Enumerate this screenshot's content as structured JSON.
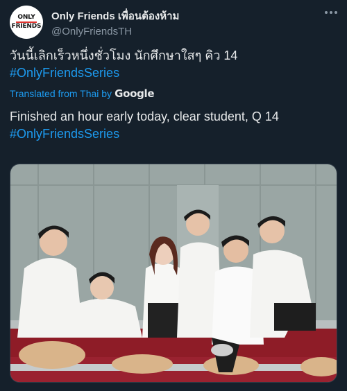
{
  "account": {
    "display_name": "Only Friends เพื่อนต้องห้าม",
    "handle": "@OnlyFriendsTH",
    "logo_text_top": "ONLY",
    "logo_text_bottom": "FRIENDS"
  },
  "tweet": {
    "original_text": "วันนี้เลิกเร็วหนึ่งชั่วโมง นักศึกษาใสๆ คิว 14",
    "original_hashtag": "#OnlyFriendsSeries",
    "translated_from": "Translated from Thai by",
    "translator": "Google",
    "translated_text": "Finished an hour early today, clear student, Q 14",
    "translated_hashtag": "#OnlyFriendsSeries"
  },
  "media": {
    "description_icon": "photo-of-six-students"
  },
  "colors": {
    "background": "#15202b",
    "link": "#1d9bf0",
    "text": "#e7e9ea",
    "muted": "#8b98a5"
  }
}
